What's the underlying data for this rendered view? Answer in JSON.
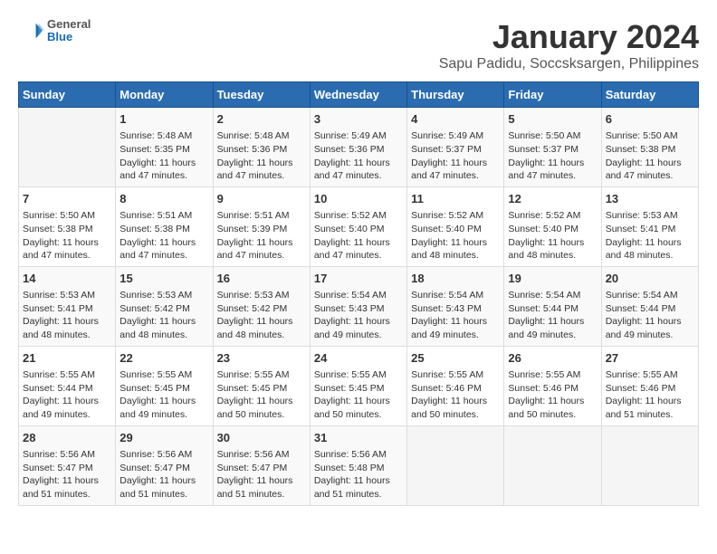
{
  "header": {
    "logo_general": "General",
    "logo_blue": "Blue",
    "title": "January 2024",
    "subtitle": "Sapu Padidu, Soccsksargen, Philippines"
  },
  "weekdays": [
    "Sunday",
    "Monday",
    "Tuesday",
    "Wednesday",
    "Thursday",
    "Friday",
    "Saturday"
  ],
  "weeks": [
    [
      {
        "day": "",
        "info": ""
      },
      {
        "day": "1",
        "info": "Sunrise: 5:48 AM\nSunset: 5:35 PM\nDaylight: 11 hours and 47 minutes."
      },
      {
        "day": "2",
        "info": "Sunrise: 5:48 AM\nSunset: 5:36 PM\nDaylight: 11 hours and 47 minutes."
      },
      {
        "day": "3",
        "info": "Sunrise: 5:49 AM\nSunset: 5:36 PM\nDaylight: 11 hours and 47 minutes."
      },
      {
        "day": "4",
        "info": "Sunrise: 5:49 AM\nSunset: 5:37 PM\nDaylight: 11 hours and 47 minutes."
      },
      {
        "day": "5",
        "info": "Sunrise: 5:50 AM\nSunset: 5:37 PM\nDaylight: 11 hours and 47 minutes."
      },
      {
        "day": "6",
        "info": "Sunrise: 5:50 AM\nSunset: 5:38 PM\nDaylight: 11 hours and 47 minutes."
      }
    ],
    [
      {
        "day": "7",
        "info": "Sunrise: 5:50 AM\nSunset: 5:38 PM\nDaylight: 11 hours and 47 minutes."
      },
      {
        "day": "8",
        "info": "Sunrise: 5:51 AM\nSunset: 5:38 PM\nDaylight: 11 hours and 47 minutes."
      },
      {
        "day": "9",
        "info": "Sunrise: 5:51 AM\nSunset: 5:39 PM\nDaylight: 11 hours and 47 minutes."
      },
      {
        "day": "10",
        "info": "Sunrise: 5:52 AM\nSunset: 5:40 PM\nDaylight: 11 hours and 47 minutes."
      },
      {
        "day": "11",
        "info": "Sunrise: 5:52 AM\nSunset: 5:40 PM\nDaylight: 11 hours and 48 minutes."
      },
      {
        "day": "12",
        "info": "Sunrise: 5:52 AM\nSunset: 5:40 PM\nDaylight: 11 hours and 48 minutes."
      },
      {
        "day": "13",
        "info": "Sunrise: 5:53 AM\nSunset: 5:41 PM\nDaylight: 11 hours and 48 minutes."
      }
    ],
    [
      {
        "day": "14",
        "info": "Sunrise: 5:53 AM\nSunset: 5:41 PM\nDaylight: 11 hours and 48 minutes."
      },
      {
        "day": "15",
        "info": "Sunrise: 5:53 AM\nSunset: 5:42 PM\nDaylight: 11 hours and 48 minutes."
      },
      {
        "day": "16",
        "info": "Sunrise: 5:53 AM\nSunset: 5:42 PM\nDaylight: 11 hours and 48 minutes."
      },
      {
        "day": "17",
        "info": "Sunrise: 5:54 AM\nSunset: 5:43 PM\nDaylight: 11 hours and 49 minutes."
      },
      {
        "day": "18",
        "info": "Sunrise: 5:54 AM\nSunset: 5:43 PM\nDaylight: 11 hours and 49 minutes."
      },
      {
        "day": "19",
        "info": "Sunrise: 5:54 AM\nSunset: 5:44 PM\nDaylight: 11 hours and 49 minutes."
      },
      {
        "day": "20",
        "info": "Sunrise: 5:54 AM\nSunset: 5:44 PM\nDaylight: 11 hours and 49 minutes."
      }
    ],
    [
      {
        "day": "21",
        "info": "Sunrise: 5:55 AM\nSunset: 5:44 PM\nDaylight: 11 hours and 49 minutes."
      },
      {
        "day": "22",
        "info": "Sunrise: 5:55 AM\nSunset: 5:45 PM\nDaylight: 11 hours and 49 minutes."
      },
      {
        "day": "23",
        "info": "Sunrise: 5:55 AM\nSunset: 5:45 PM\nDaylight: 11 hours and 50 minutes."
      },
      {
        "day": "24",
        "info": "Sunrise: 5:55 AM\nSunset: 5:45 PM\nDaylight: 11 hours and 50 minutes."
      },
      {
        "day": "25",
        "info": "Sunrise: 5:55 AM\nSunset: 5:46 PM\nDaylight: 11 hours and 50 minutes."
      },
      {
        "day": "26",
        "info": "Sunrise: 5:55 AM\nSunset: 5:46 PM\nDaylight: 11 hours and 50 minutes."
      },
      {
        "day": "27",
        "info": "Sunrise: 5:55 AM\nSunset: 5:46 PM\nDaylight: 11 hours and 51 minutes."
      }
    ],
    [
      {
        "day": "28",
        "info": "Sunrise: 5:56 AM\nSunset: 5:47 PM\nDaylight: 11 hours and 51 minutes."
      },
      {
        "day": "29",
        "info": "Sunrise: 5:56 AM\nSunset: 5:47 PM\nDaylight: 11 hours and 51 minutes."
      },
      {
        "day": "30",
        "info": "Sunrise: 5:56 AM\nSunset: 5:47 PM\nDaylight: 11 hours and 51 minutes."
      },
      {
        "day": "31",
        "info": "Sunrise: 5:56 AM\nSunset: 5:48 PM\nDaylight: 11 hours and 51 minutes."
      },
      {
        "day": "",
        "info": ""
      },
      {
        "day": "",
        "info": ""
      },
      {
        "day": "",
        "info": ""
      }
    ]
  ]
}
